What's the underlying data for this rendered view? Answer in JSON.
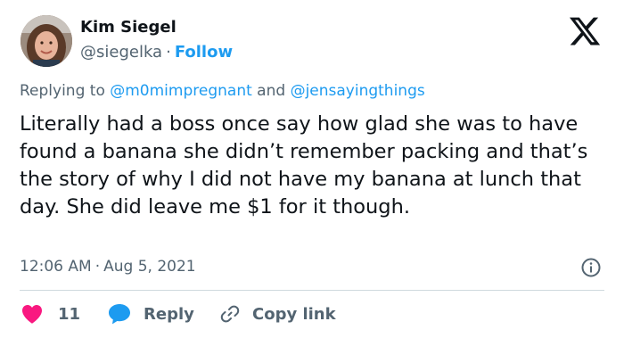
{
  "author": {
    "name": "Kim Siegel",
    "handle": "@siegelka",
    "separator": "·",
    "follow_label": "Follow"
  },
  "reply_context": {
    "prefix": "Replying to",
    "mention_1": "@m0mimpregnant",
    "conjunction": "and",
    "mention_2": "@jensayingthings"
  },
  "tweet": {
    "text": "Literally had a boss once say how glad she was to have found a banana she didn’t remember packing and that’s the story of why I did not have my banana at lunch that day. She did leave me $1 for it though.",
    "time": "12:06 AM",
    "separator": "·",
    "date": "Aug 5, 2021"
  },
  "actions": {
    "like_count": "11",
    "reply_label": "Reply",
    "copy_link_label": "Copy link"
  },
  "icons": {
    "logo": "x-logo-icon",
    "info": "info-icon",
    "like": "heart-icon",
    "reply": "speech-bubble-icon",
    "copy": "link-icon"
  },
  "colors": {
    "accent": "#1d9bf0",
    "like": "#f91880",
    "text": "#0f1419",
    "secondary": "#536471",
    "divider": "#cfd9de"
  }
}
